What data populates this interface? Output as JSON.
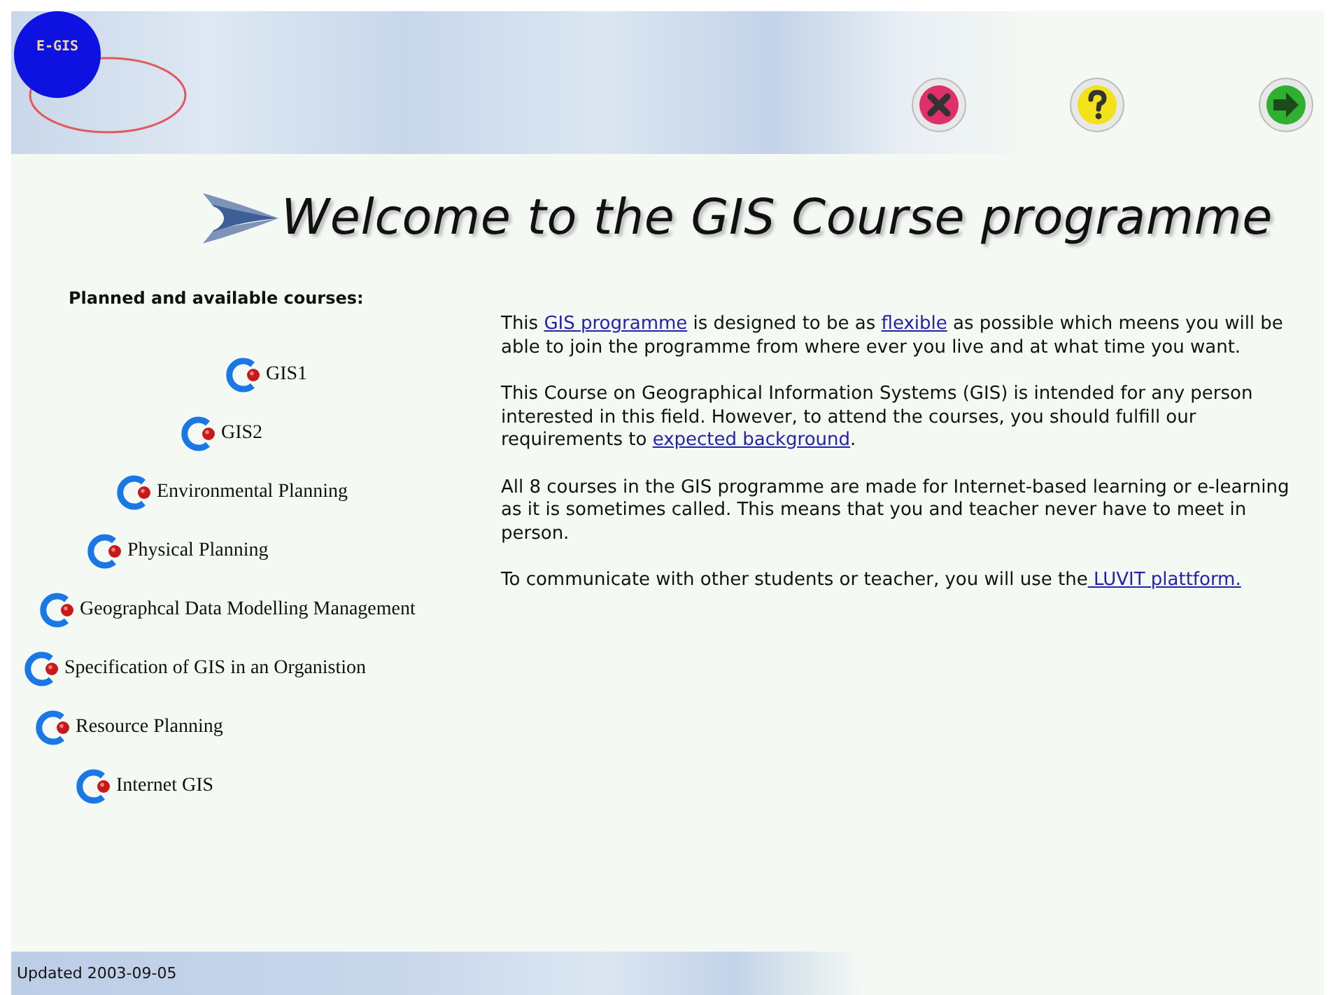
{
  "logo": {
    "text": "E-GIS"
  },
  "header_buttons": [
    {
      "kind": "close"
    },
    {
      "kind": "help"
    },
    {
      "kind": "next"
    }
  ],
  "title": "Welcome to the GIS Course programme",
  "courses_heading": "Planned and available courses:",
  "courses": [
    {
      "label": "GIS1"
    },
    {
      "label": "GIS2"
    },
    {
      "label": "Environmental Planning"
    },
    {
      "label": "Physical Planning"
    },
    {
      "label": "Geographcal Data Modelling Management"
    },
    {
      "label": "Specification of GIS in an Organistion"
    },
    {
      "label": "Resource Planning"
    },
    {
      "label": "Internet GIS"
    }
  ],
  "paragraphs": [
    [
      {
        "kind": "text",
        "text": "This "
      },
      {
        "kind": "link",
        "text": "GIS programme"
      },
      {
        "kind": "text",
        "text": " is designed to be as "
      },
      {
        "kind": "link",
        "text": "flexible"
      },
      {
        "kind": "text",
        "text": " as possible which meens you will be able to join the programme from where ever you live and at what time you want."
      }
    ],
    [
      {
        "kind": "text",
        "text": "This Course on Geographical Information Systems (GIS) is intended for any person interested in this field. However, to attend the courses, you should fulfill our requirements to "
      },
      {
        "kind": "link",
        "text": "expected background"
      },
      {
        "kind": "text",
        "text": "."
      }
    ],
    [
      {
        "kind": "text",
        "text": "All 8 courses in the GIS programme are made for Internet-based learning or e-learning as it is sometimes called. This means that you and teacher never have to meet in person."
      }
    ],
    [
      {
        "kind": "text",
        "text": "To communicate with other students or teacher, you will use the"
      },
      {
        "kind": "link",
        "text": " LUVIT plattform."
      }
    ]
  ],
  "footer": "Updated 2003-09-05"
}
